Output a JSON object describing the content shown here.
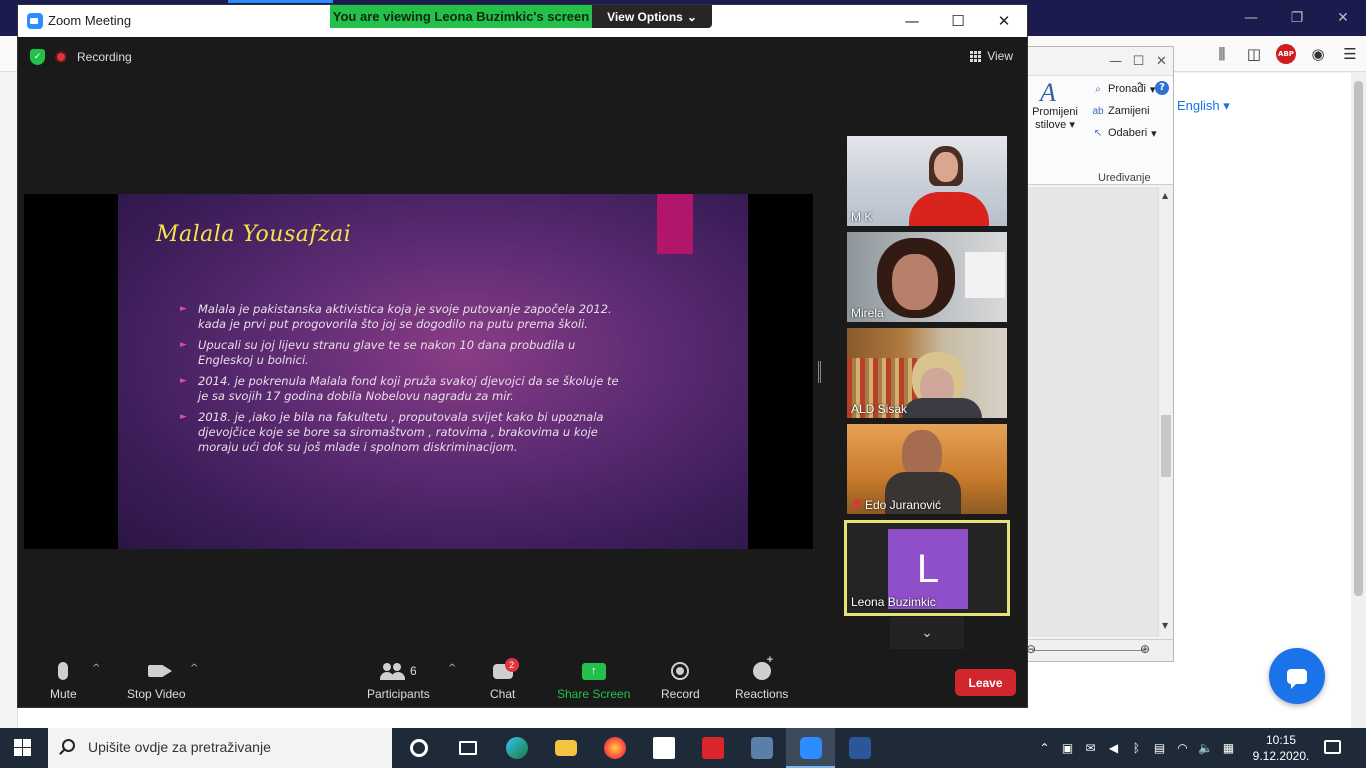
{
  "zoom": {
    "window_title": "Zoom Meeting",
    "viewing_banner": "You are viewing Leona Buzimkic's screen",
    "view_options": "View Options",
    "recording_label": "Recording",
    "view_label": "View"
  },
  "slide": {
    "title": "Malala Yousafzai",
    "bullets": [
      "Malala je pakistanska aktivistica koja je svoje putovanje započela 2012. kada je prvi put progovorila što joj se dogodilo na putu prema školi.",
      "Upucali su joj lijevu stranu glave te se nakon 10 dana probudila u Engleskoj u bolnici.",
      "2014. je pokrenula Malala fond koji pruža svakoj djevojci da se školuje te je sa svojih 17 godina dobila Nobelovu nagradu za mir.",
      "2018. je ,iako je bila na fakultetu , proputovala svijet kako bi upoznala djevojčice koje se bore sa siromaštvom , ratovima , brakovima u koje moraju ući dok su još mlade i spolnom diskriminacijom."
    ]
  },
  "participants_gallery": [
    {
      "name": "M K",
      "muted": false
    },
    {
      "name": "Mirela",
      "muted": false
    },
    {
      "name": "ALD Sisak",
      "muted": false
    },
    {
      "name": "Edo Juranović",
      "muted": true
    },
    {
      "name": "Leona Buzimkic",
      "avatar_letter": "L",
      "avatar_color": "#8e4fc8",
      "active_speaker": true
    }
  ],
  "toolbar": {
    "mute": "Mute",
    "stop_video": "Stop Video",
    "participants": "Participants",
    "participants_count": "6",
    "chat": "Chat",
    "chat_badge": "2",
    "share_screen": "Share Screen",
    "record": "Record",
    "reactions": "Reactions",
    "leave": "Leave"
  },
  "word": {
    "promijeni_stilove": "Promijeni stilove",
    "pronadi": "Pronađi",
    "zamijeni": "Zamijeni",
    "odaberi": "Odaberi",
    "group_label": "Uređivanje"
  },
  "browser": {
    "language_link": "English"
  },
  "taskbar": {
    "search_placeholder": "Upišite ovdje za pretraživanje",
    "time": "10:15",
    "date": "9.12.2020."
  },
  "colors": {
    "zoom_green": "#23c04b",
    "leave_red": "#d1262e",
    "active_speaker_border": "#e6e277",
    "slide_title": "#f4e34a"
  }
}
